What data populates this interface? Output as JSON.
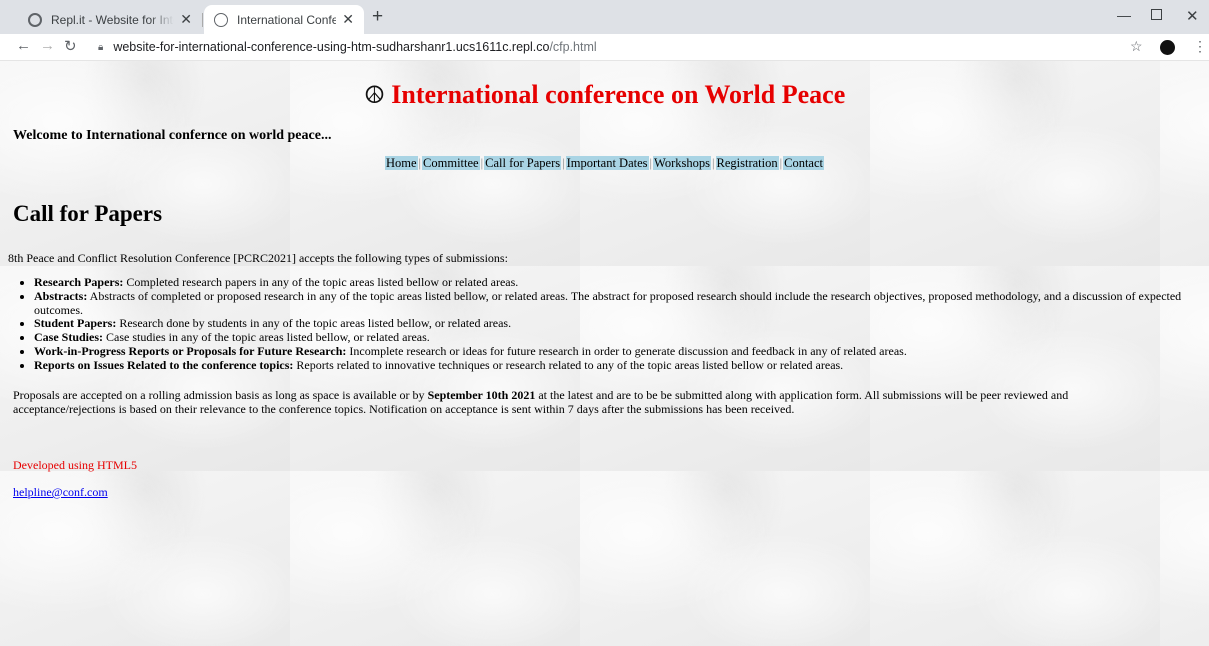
{
  "browser": {
    "tabs": [
      {
        "title": "Repl.it - Website for International",
        "icon": "replit-icon",
        "active": false
      },
      {
        "title": "International Conference",
        "icon": "globe-icon",
        "active": true
      }
    ],
    "url_host": "website-for-international-conference-using-htm-sudharshanr1.ucs1611c.repl.co",
    "url_path": "/cfp.html"
  },
  "page": {
    "title": "International conference on World Peace",
    "title_icon": "☮",
    "welcome": "Welcome to International confernce on world peace...",
    "nav": [
      "Home",
      "Committee",
      "Call for Papers",
      "Important Dates",
      "Workshops",
      "Registration",
      "Contact"
    ],
    "section_title": "Call for Papers",
    "intro": "8th Peace and Conflict Resolution Conference [PCRC2021] accepts the following types of submissions:",
    "submission_types": [
      {
        "label": "Research Papers:",
        "text": " Completed research papers in any of the topic areas listed bellow or related areas."
      },
      {
        "label": "Abstracts:",
        "text": " Abstracts of completed or proposed research in any of the topic areas listed bellow, or related areas. The abstract for proposed research should include the research objectives, proposed methodology, and a discussion of expected outcomes."
      },
      {
        "label": "Student Papers:",
        "text": " Research done by students in any of the topic areas listed bellow, or related areas."
      },
      {
        "label": "Case Studies:",
        "text": " Case studies in any of the topic areas listed bellow, or related areas."
      },
      {
        "label": "Work-in-Progress Reports or Proposals for Future Research:",
        "text": " Incomplete research or ideas for future research in order to generate discussion and feedback in any of related areas."
      },
      {
        "label": "Reports on Issues Related to the conference topics:",
        "text": " Reports related to innovative techniques or research related to any of the topic areas listed bellow or related areas."
      }
    ],
    "proposal_before": "Proposals are accepted on a rolling admission basis as long as space is available or by ",
    "proposal_date": "September 10th 2021",
    "proposal_after": " at the latest and are to be be submitted along with application form. All submissions will be peer reviewed and acceptance/rejections is based on their relevance to the conference topics. Notification on acceptance is sent within 7 days after the submissions has been received.",
    "developed": "Developed using HTML5",
    "helpline": "helpline@conf.com"
  },
  "colors": {
    "title": "#e60000",
    "nav_bg": "#a9d4e4",
    "link": "#0000ee"
  }
}
